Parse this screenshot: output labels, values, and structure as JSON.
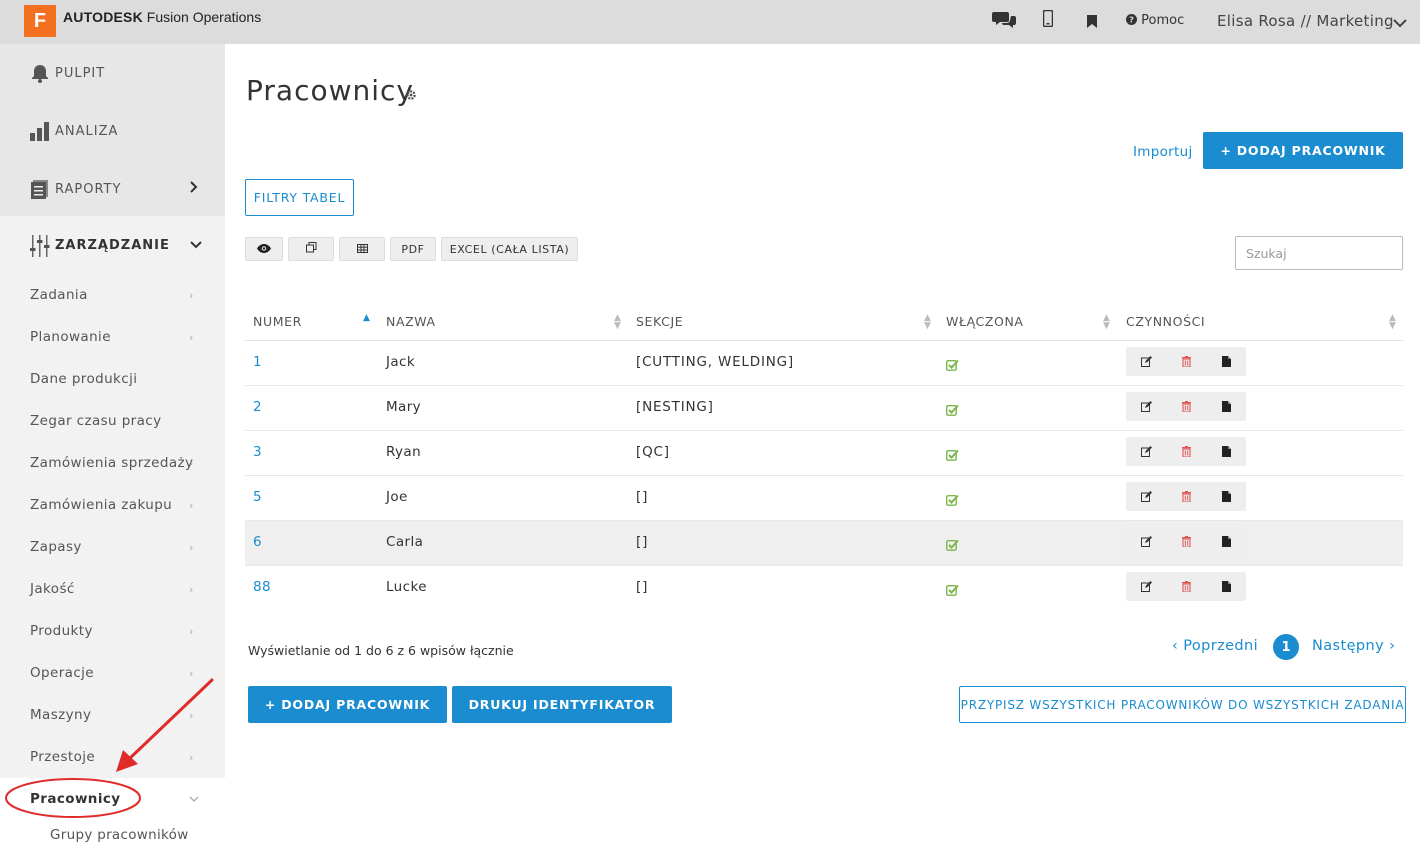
{
  "app": {
    "logo_letter": "F",
    "brand": "AUTODESK",
    "product": "Fusion Operations",
    "help_label": "Pomoc",
    "user_label": "Elisa Rosa // Marketing"
  },
  "sidebar": {
    "main": [
      {
        "label": "PULPIT",
        "icon": "bell-icon"
      },
      {
        "label": "ANALIZA",
        "icon": "bar-chart-icon"
      },
      {
        "label": "RAPORTY",
        "icon": "reports-icon"
      },
      {
        "label": "ZARZĄDZANIE",
        "icon": "sliders-icon"
      }
    ],
    "items": [
      {
        "label": "Zadania"
      },
      {
        "label": "Planowanie"
      },
      {
        "label": "Dane produkcji"
      },
      {
        "label": "Zegar czasu pracy"
      },
      {
        "label": "Zamówienia sprzedaży"
      },
      {
        "label": "Zamówienia zakupu"
      },
      {
        "label": "Zapasy"
      },
      {
        "label": "Jakość"
      },
      {
        "label": "Produkty"
      },
      {
        "label": "Operacje"
      },
      {
        "label": "Maszyny"
      },
      {
        "label": "Przestoje"
      },
      {
        "label": "Pracownicy"
      }
    ],
    "sub_item": "Grupy pracowników"
  },
  "main": {
    "title": "Pracownicy",
    "import_label": "Importuj",
    "add_button_top": "+ DODAJ PRACOWNIK",
    "filters_button": "FILTRY TABEL",
    "tools": {
      "pdf": "PDF",
      "excel": "EXCEL (CAŁA LISTA)"
    },
    "search_placeholder": "Szukaj"
  },
  "table": {
    "columns": [
      "NUMER",
      "NAZWA",
      "SEKCJE",
      "WŁĄCZONA",
      "CZYNNOŚCI"
    ],
    "rows": [
      {
        "numer": "1",
        "nazwa": "Jack",
        "sekcje": "[CUTTING, WELDING]",
        "enabled": true
      },
      {
        "numer": "2",
        "nazwa": "Mary",
        "sekcje": "[NESTING]",
        "enabled": true
      },
      {
        "numer": "3",
        "nazwa": "Ryan",
        "sekcje": "[QC]",
        "enabled": true
      },
      {
        "numer": "5",
        "nazwa": "Joe",
        "sekcje": "[]",
        "enabled": true
      },
      {
        "numer": "6",
        "nazwa": "Carla",
        "sekcje": "[]",
        "enabled": true
      },
      {
        "numer": "88",
        "nazwa": "Lucke",
        "sekcje": "[]",
        "enabled": true
      }
    ]
  },
  "footer": {
    "info": "Wyświetlanie od 1 do 6 z 6 wpisów łącznie",
    "prev": "‹ Poprzedni",
    "page": "1",
    "next": "Następny ›",
    "add_button": "+ DODAJ PRACOWNIK",
    "print_button": "DRUKUJ IDENTYFIKATOR",
    "assign_button": "PRZYPISZ WSZYSTKICH PRACOWNIKÓW DO WSZYSTKICH ZADANIA"
  },
  "colors": {
    "accent": "#1a8ccf",
    "logo": "#f37021",
    "check": "#7ab648",
    "delete": "#e05555",
    "annotation": "#e02b2b"
  }
}
